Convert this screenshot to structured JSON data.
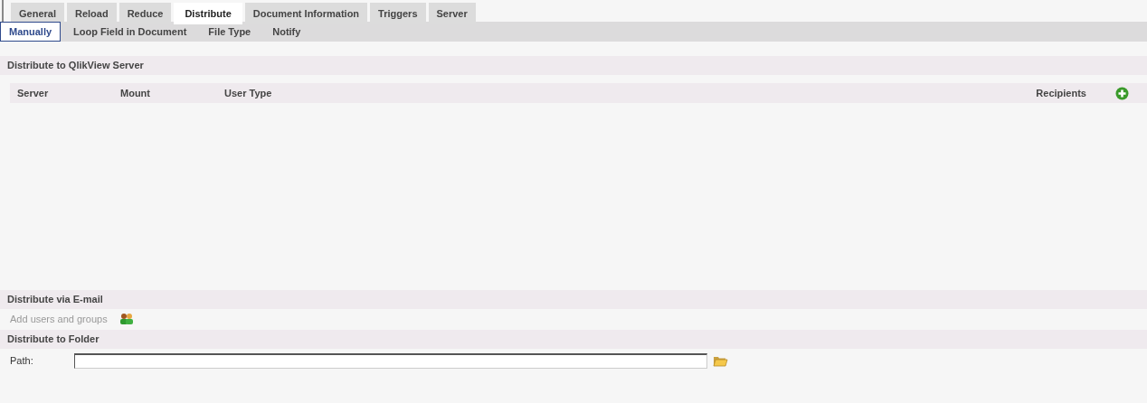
{
  "tabs": [
    {
      "label": "General",
      "selected": false
    },
    {
      "label": "Reload",
      "selected": false
    },
    {
      "label": "Reduce",
      "selected": false
    },
    {
      "label": "Distribute",
      "selected": true
    },
    {
      "label": "Document Information",
      "selected": false
    },
    {
      "label": "Triggers",
      "selected": false
    },
    {
      "label": "Server",
      "selected": false
    }
  ],
  "subtabs": [
    {
      "label": "Manually",
      "selected": true
    },
    {
      "label": "Loop Field in Document",
      "selected": false
    },
    {
      "label": "File Type",
      "selected": false
    },
    {
      "label": "Notify",
      "selected": false
    }
  ],
  "server_section": {
    "title": "Distribute to QlikView Server",
    "columns": [
      "Server",
      "Mount",
      "User Type",
      "Recipients"
    ]
  },
  "email_section": {
    "title": "Distribute via E-mail",
    "add_label": "Add users and groups"
  },
  "folder_section": {
    "title": "Distribute to Folder",
    "path_label": "Path:"
  }
}
